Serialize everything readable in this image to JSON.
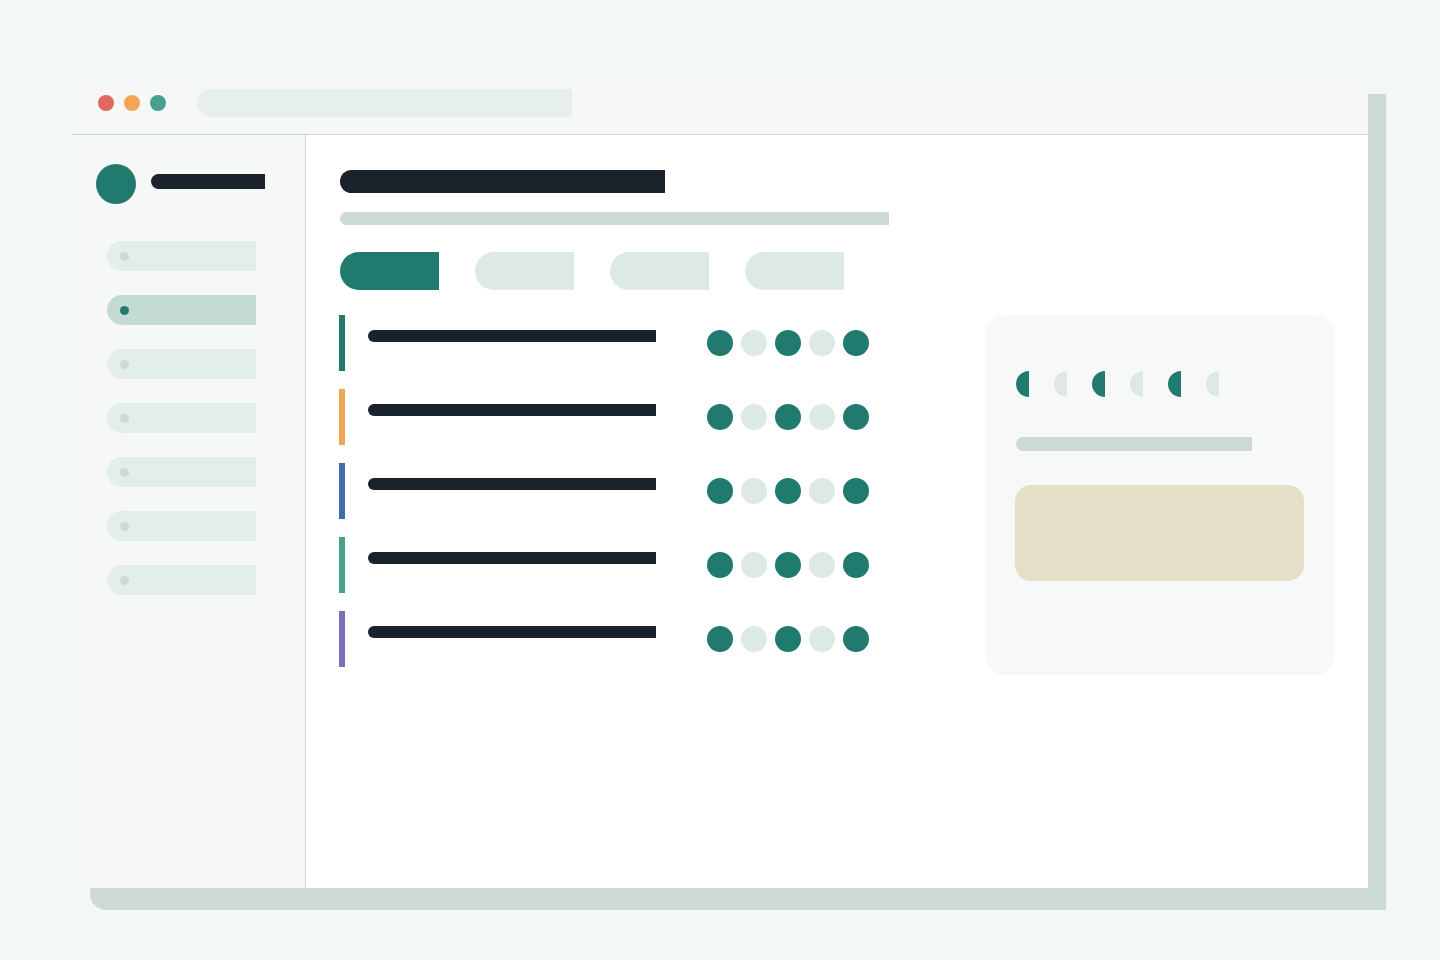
{
  "window": {
    "controls": [
      {
        "color": "#e0675c"
      },
      {
        "color": "#f0a653"
      },
      {
        "color": "#45a08c"
      }
    ]
  },
  "sidebar": {
    "items": [
      {
        "selected": false
      },
      {
        "selected": true
      },
      {
        "selected": false
      },
      {
        "selected": false
      },
      {
        "selected": false
      },
      {
        "selected": false
      },
      {
        "selected": false
      }
    ]
  },
  "tabs": [
    {
      "selected": true
    },
    {
      "selected": false
    },
    {
      "selected": false
    },
    {
      "selected": false
    }
  ],
  "rows": [
    {
      "color": "#217a6e",
      "dots": [
        {
          "on": true
        },
        {
          "on": false
        },
        {
          "on": true
        },
        {
          "on": false
        },
        {
          "on": true
        }
      ]
    },
    {
      "color": "#f0a653",
      "dots": [
        {
          "on": true
        },
        {
          "on": false
        },
        {
          "on": true
        },
        {
          "on": false
        },
        {
          "on": true
        }
      ]
    },
    {
      "color": "#3f6bb0",
      "dots": [
        {
          "on": true
        },
        {
          "on": false
        },
        {
          "on": true
        },
        {
          "on": false
        },
        {
          "on": true
        }
      ]
    },
    {
      "color": "#45a08c",
      "dots": [
        {
          "on": true
        },
        {
          "on": false
        },
        {
          "on": true
        },
        {
          "on": false
        },
        {
          "on": true
        }
      ]
    },
    {
      "color": "#7a72b8",
      "dots": [
        {
          "on": true
        },
        {
          "on": false
        },
        {
          "on": true
        },
        {
          "on": false
        },
        {
          "on": true
        }
      ]
    }
  ],
  "card": {
    "dots": [
      {
        "on": true
      },
      {
        "on": false
      },
      {
        "on": true
      },
      {
        "on": false
      },
      {
        "on": true
      },
      {
        "on": false
      }
    ]
  }
}
